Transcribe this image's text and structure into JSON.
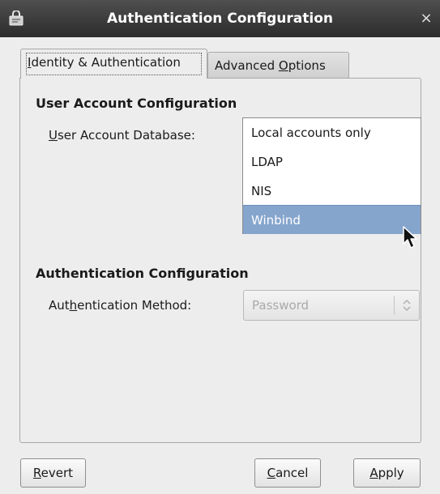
{
  "window": {
    "title": "Authentication Configuration",
    "close_glyph": "×"
  },
  "tabs": [
    {
      "pre": "",
      "mnemonic": "I",
      "post": "dentity & Authentication",
      "active": true
    },
    {
      "pre": "Advanced ",
      "mnemonic": "O",
      "post": "ptions",
      "active": false
    }
  ],
  "user_account": {
    "section_title": "User Account Configuration",
    "label_pre": "",
    "label_mnemonic": "U",
    "label_post": "ser Account Database:",
    "options": [
      "Local accounts only",
      "LDAP",
      "NIS",
      "Winbind"
    ],
    "highlighted_option": "Winbind"
  },
  "authentication": {
    "section_title": "Authentication Configuration",
    "label_pre": "Aut",
    "label_mnemonic": "h",
    "label_post": "entication Method:",
    "value": "Password",
    "disabled": true
  },
  "buttons": {
    "revert": {
      "mnemonic": "R",
      "post": "evert"
    },
    "cancel": {
      "mnemonic": "C",
      "post": "ancel"
    },
    "apply": {
      "mnemonic": "A",
      "post": "pply"
    }
  },
  "icons": {
    "app": "authentication-app-icon",
    "close": "close-icon",
    "combo_arrows": "up-down-arrows-icon",
    "cursor": "mouse-pointer-icon"
  },
  "colors": {
    "titlebar": "#3a3a3a",
    "selection": "#86a5cd",
    "window_bg": "#ededed"
  }
}
